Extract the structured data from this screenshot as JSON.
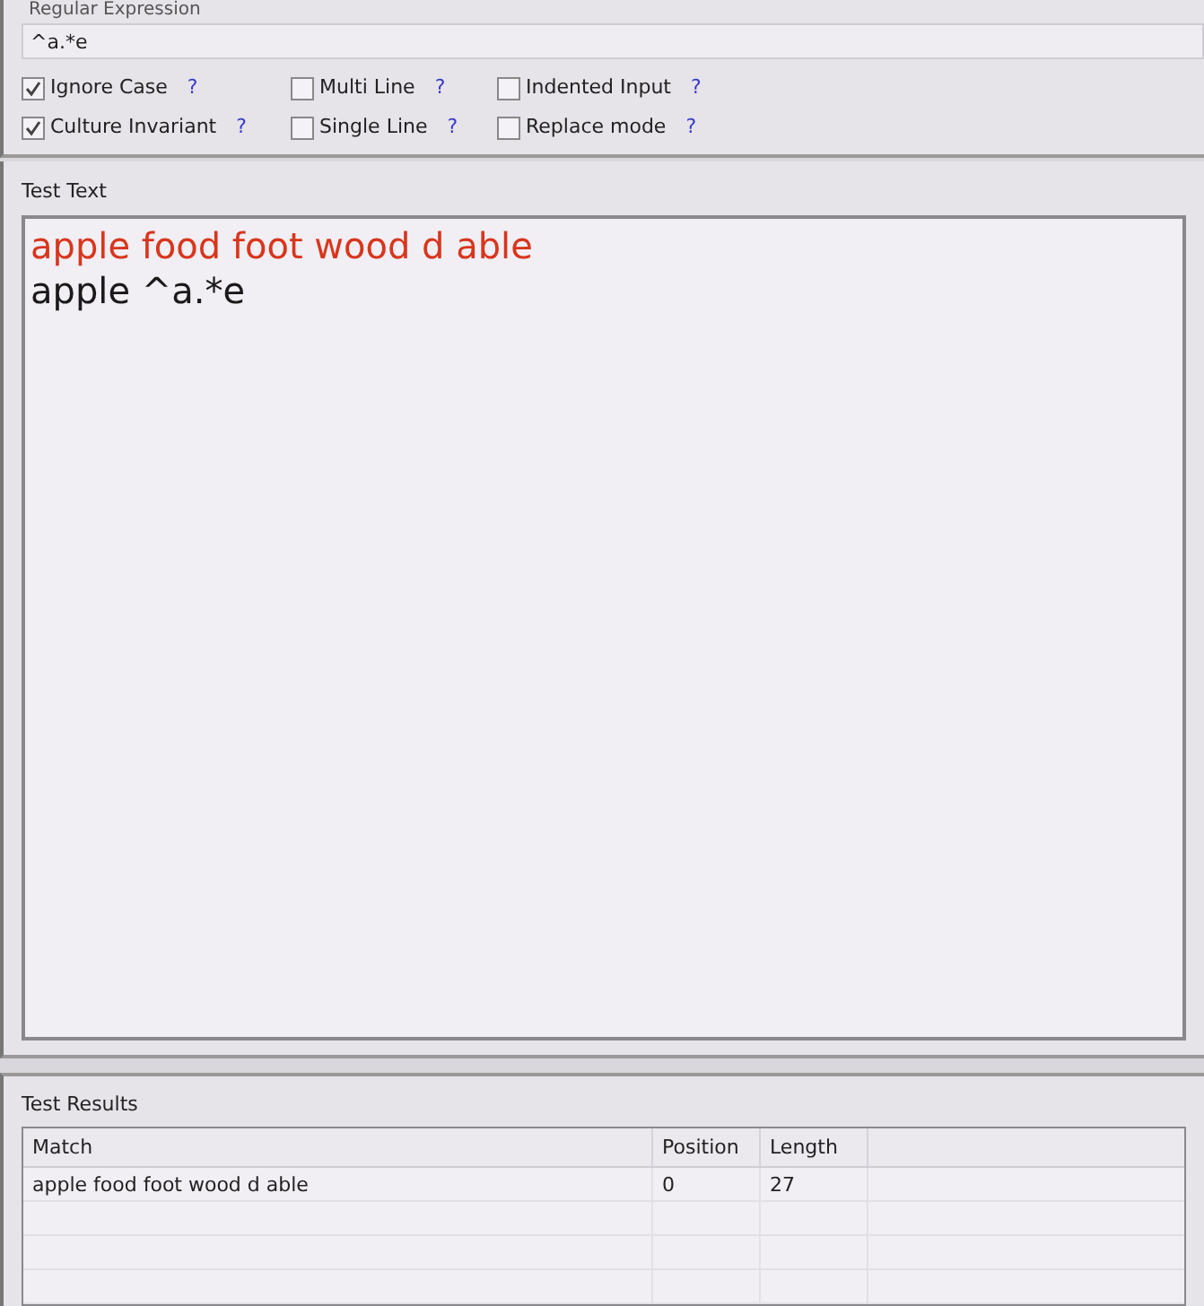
{
  "regex_panel": {
    "title": "Regular Expression",
    "value": "^a.*e",
    "options": [
      {
        "label": "Ignore Case",
        "checked": true,
        "help": "?"
      },
      {
        "label": "Multi Line",
        "checked": false,
        "help": "?"
      },
      {
        "label": "Indented Input",
        "checked": false,
        "help": "?"
      },
      {
        "label": "Culture Invariant",
        "checked": true,
        "help": "?"
      },
      {
        "label": "Single Line",
        "checked": false,
        "help": "?"
      },
      {
        "label": "Replace mode",
        "checked": false,
        "help": "?"
      }
    ]
  },
  "test_text": {
    "title": "Test Text",
    "lines": [
      {
        "text": "apple food foot wood d able",
        "matched": true
      },
      {
        "text": "apple ^a.*e",
        "matched": false
      }
    ]
  },
  "test_results": {
    "title": "Test Results",
    "columns": [
      "Match",
      "Position",
      "Length"
    ],
    "rows": [
      [
        "apple food foot wood d able",
        "0",
        "27"
      ]
    ]
  }
}
